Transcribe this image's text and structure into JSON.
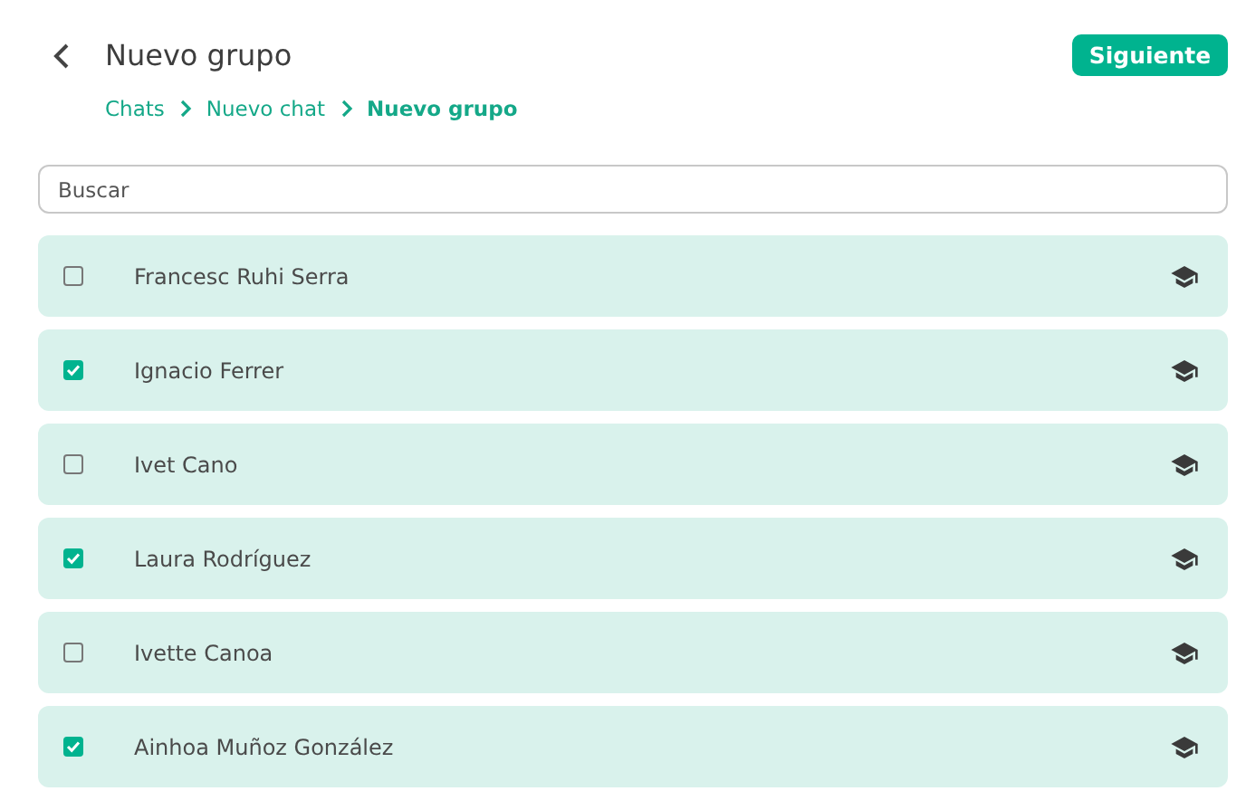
{
  "header": {
    "title": "Nuevo grupo",
    "next_button": "Siguiente"
  },
  "breadcrumbs": [
    {
      "label": "Chats",
      "current": false
    },
    {
      "label": "Nuevo chat",
      "current": false
    },
    {
      "label": "Nuevo grupo",
      "current": true
    }
  ],
  "search": {
    "placeholder": "Buscar"
  },
  "contacts": [
    {
      "name": "Francesc Ruhi Serra",
      "checked": false
    },
    {
      "name": "Ignacio Ferrer",
      "checked": true
    },
    {
      "name": "Ivet Cano",
      "checked": false
    },
    {
      "name": "Laura Rodríguez",
      "checked": true
    },
    {
      "name": "Ivette Canoa",
      "checked": false
    },
    {
      "name": "Ainhoa Muñoz González",
      "checked": true
    }
  ]
}
